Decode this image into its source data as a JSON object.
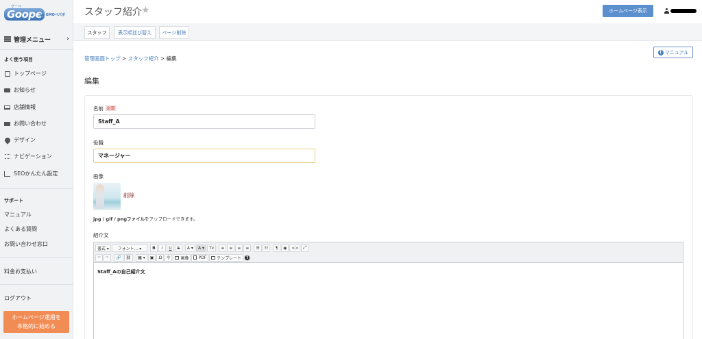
{
  "logo": {
    "ruby": "グーペ",
    "main": "Goope",
    "sub": "by GMOペパボ"
  },
  "sidebar": {
    "menu_label": "管理メニュー",
    "menu_chevron": "›",
    "frequent_label": "よく使う項目",
    "items": [
      {
        "label": "トップページ",
        "icon": "page-icon"
      },
      {
        "label": "お知らせ",
        "icon": "message-icon"
      },
      {
        "label": "店舗情報",
        "icon": "computer-icon"
      },
      {
        "label": "お問い合わせ",
        "icon": "mail-icon"
      },
      {
        "label": "デザイン",
        "icon": "palette-icon"
      },
      {
        "label": "ナビゲーション",
        "icon": "list-icon"
      },
      {
        "label": "SEOかんたん設定",
        "icon": "chart-icon"
      }
    ],
    "support_label": "サポート",
    "support_items": [
      "マニュアル",
      "よくある質問",
      "お問い合わせ窓口"
    ],
    "billing": "料金お支払い",
    "logout": "ログアウト",
    "promo_line1": "ホームページ運用を",
    "promo_line2": "本格的に始める"
  },
  "header": {
    "title": "スタッフ紹介",
    "star": "★",
    "homepage_button": "ホームページ表示"
  },
  "tabs": [
    "スタッフ",
    "表示順並び替え",
    "ページ削除"
  ],
  "breadcrumb": {
    "home": "管理画面トップ",
    "sep": ">",
    "section": "スタッフ紹介",
    "current": "編集"
  },
  "manual_button": "マニュアル",
  "section_title": "編集",
  "form": {
    "name_label": "名前",
    "required_badge": "必須",
    "name_value": "Staff_A",
    "role_label": "役職",
    "role_value": "マネージャー",
    "image_label": "画像",
    "delete_link": "削除",
    "hint_formats": "jpg / gif / pngファイル",
    "hint_rest": "をアップロードできます。",
    "intro_label": "紹介文",
    "intro_text": "Staff_Aの自己紹介文"
  },
  "editor_toolbar": {
    "format": "書式 ▾",
    "font": "フォント... ▾",
    "bold": "B",
    "italic": "I",
    "underline": "U",
    "strike": "S",
    "text_color": "A ▾",
    "bg_color": "A ▾",
    "clear": "Tx",
    "align_left": "≡",
    "align_center": "≡",
    "align_right": "≡",
    "justify": "≡",
    "bullets": "☰",
    "numbered": "☷",
    "para": "¶",
    "preview": "◉",
    "source": "<>",
    "fullscreen": "⤢",
    "undo": "↶",
    "redo": "↷",
    "link": "🔗",
    "unlink": "⛓",
    "table": "▦ ▾",
    "media": "▣",
    "omega": "Ω",
    "find": "⚲",
    "image": "画像",
    "pdf": "PDF",
    "template": "テンプレート",
    "help": "?"
  }
}
